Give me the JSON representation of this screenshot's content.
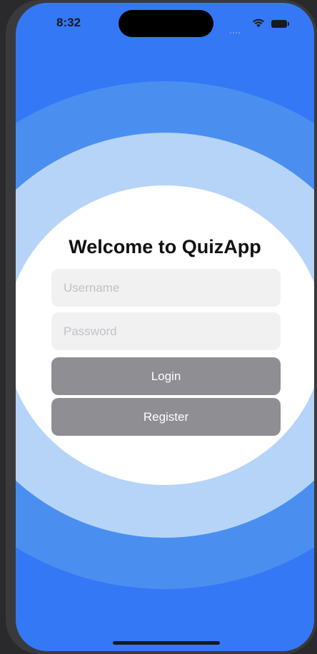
{
  "status_bar": {
    "time": "8:32",
    "icons": [
      "cellular-signal-icon",
      "wifi-icon",
      "battery-icon"
    ]
  },
  "login": {
    "title": "Welcome to QuizApp",
    "username_placeholder": "Username",
    "username_value": "",
    "password_placeholder": "Password",
    "password_value": "",
    "login_label": "Login",
    "register_label": "Register"
  },
  "colors": {
    "background": "#3478f6",
    "ring_outer": "#4a8ff0",
    "ring_middle": "#b6d4f8",
    "ring_inner": "#ffffff",
    "field_background": "#f1f1f2",
    "button_background": "#8e8e93",
    "button_text": "#ffffff"
  }
}
